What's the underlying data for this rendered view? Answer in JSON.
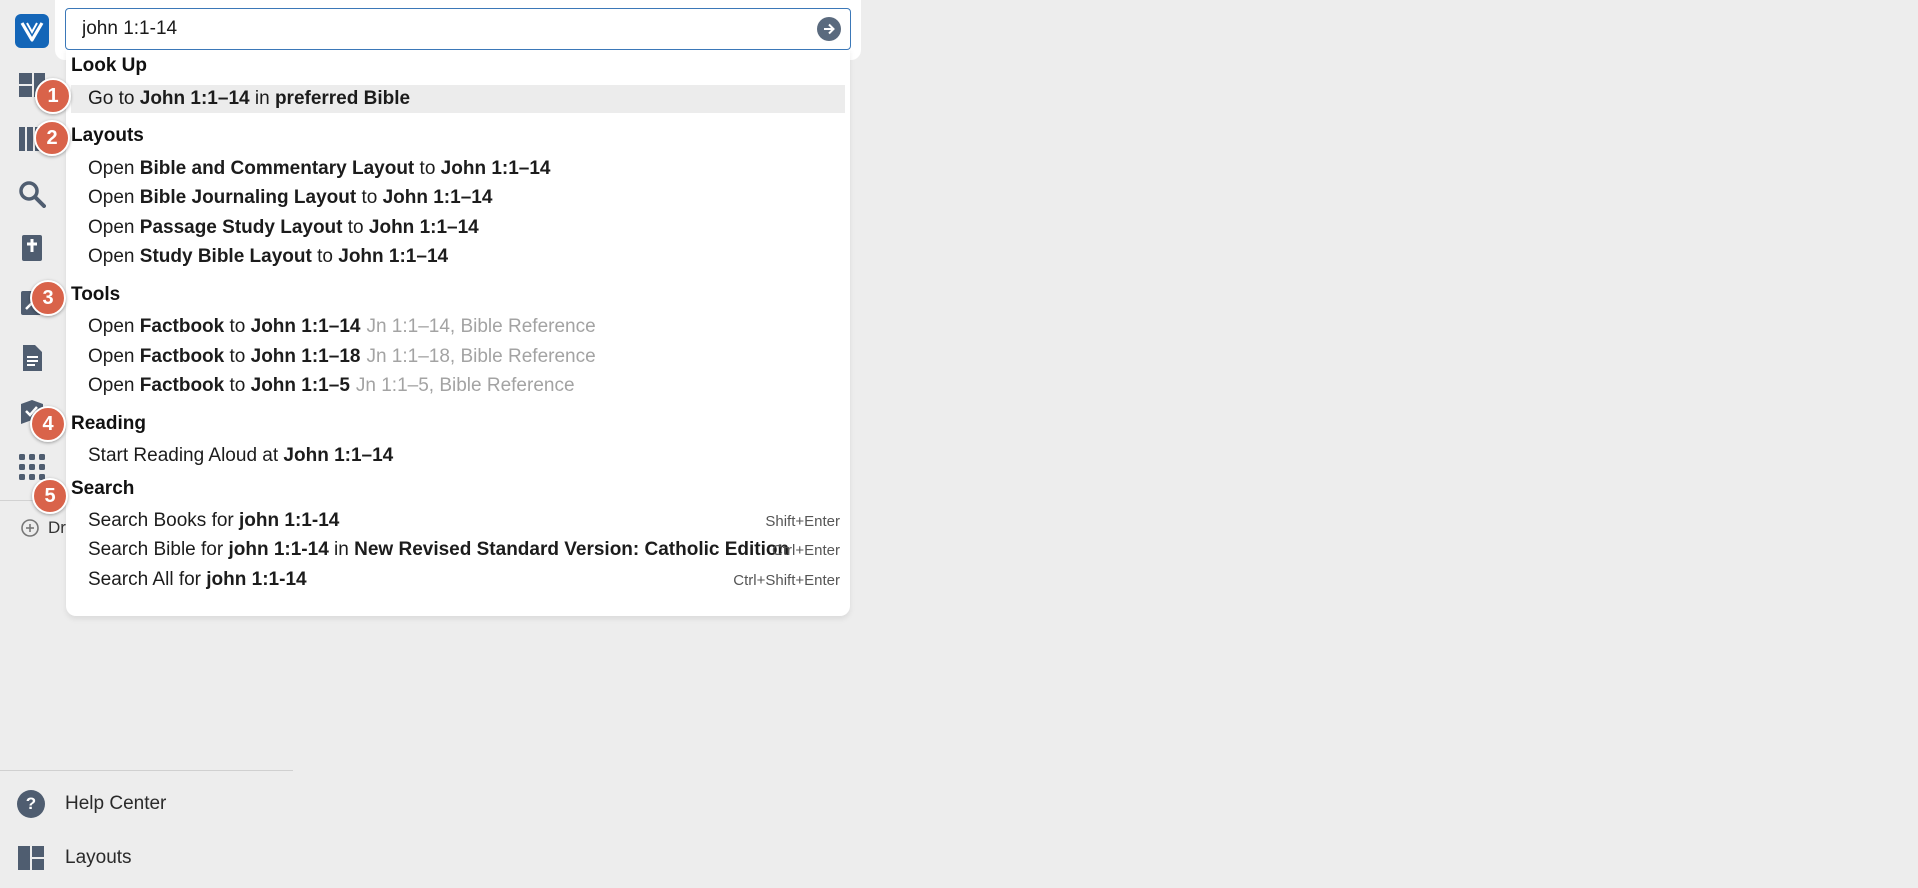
{
  "search": {
    "value": "john 1:1-14"
  },
  "sections": [
    {
      "title": "Look Up",
      "items": [
        {
          "pre": "Go to ",
          "bold1": "John 1:1–14",
          "mid": " in ",
          "bold2": "preferred Bible",
          "post": "",
          "muted": "",
          "shortcut": "",
          "selected": true
        }
      ]
    },
    {
      "title": "Layouts",
      "items": [
        {
          "pre": "Open ",
          "bold1": "Bible and Commentary Layout",
          "mid": " to ",
          "bold2": "John 1:1–14",
          "post": "",
          "muted": "",
          "shortcut": ""
        },
        {
          "pre": "Open ",
          "bold1": "Bible Journaling Layout",
          "mid": " to ",
          "bold2": "John 1:1–14",
          "post": "",
          "muted": "",
          "shortcut": ""
        },
        {
          "pre": "Open ",
          "bold1": "Passage Study Layout",
          "mid": " to ",
          "bold2": "John 1:1–14",
          "post": "",
          "muted": "",
          "shortcut": ""
        },
        {
          "pre": "Open ",
          "bold1": "Study Bible Layout",
          "mid": " to ",
          "bold2": "John 1:1–14",
          "post": "",
          "muted": "",
          "shortcut": ""
        }
      ]
    },
    {
      "title": "Tools",
      "items": [
        {
          "pre": "Open ",
          "bold1": "Factbook",
          "mid": " to ",
          "bold2": "John 1:1–14",
          "post": "",
          "muted": "Jn 1:1–14, Bible Reference",
          "shortcut": ""
        },
        {
          "pre": "Open ",
          "bold1": "Factbook",
          "mid": " to ",
          "bold2": "John 1:1–18",
          "post": "",
          "muted": "Jn 1:1–18, Bible Reference",
          "shortcut": ""
        },
        {
          "pre": "Open ",
          "bold1": "Factbook",
          "mid": " to ",
          "bold2": "John 1:1–5",
          "post": "",
          "muted": "Jn 1:1–5, Bible Reference",
          "shortcut": ""
        }
      ]
    },
    {
      "title": "Reading",
      "items": [
        {
          "pre": "Start Reading Aloud at ",
          "bold1": "John 1:1–14",
          "mid": "",
          "bold2": "",
          "post": "",
          "muted": "",
          "shortcut": ""
        }
      ]
    },
    {
      "title": "Search",
      "items": [
        {
          "pre": "Search Books for ",
          "bold1": "john 1:1-14",
          "mid": "",
          "bold2": "",
          "post": "",
          "muted": "",
          "shortcut": "Shift+Enter"
        },
        {
          "pre": "Search Bible for ",
          "bold1": "john 1:1-14",
          "mid": " in ",
          "bold2": "New Revised Standard Version: Catholic Edition",
          "post": "",
          "muted": "",
          "shortcut": "Ctrl+Enter"
        },
        {
          "pre": "Search All for ",
          "bold1": "john 1:1-14",
          "mid": "",
          "bold2": "",
          "post": "",
          "muted": "",
          "shortcut": "Ctrl+Shift+Enter"
        }
      ]
    }
  ],
  "badges": [
    "1",
    "2",
    "3",
    "4",
    "5"
  ],
  "sidebar": {
    "add_label": "Dr",
    "help_center": "Help Center",
    "layouts": "Layouts",
    "icons": [
      "logo-icon",
      "dashboard-icon",
      "library-icon",
      "search-icon",
      "bible-icon",
      "notes-icon",
      "document-icon",
      "courses-icon",
      "apps-icon"
    ]
  },
  "colors": {
    "accent": "#1466b8",
    "badge": "#d9634a",
    "rail_icon": "#4f5d70",
    "muted_text": "#a3a3a3",
    "selection": "#ececec"
  }
}
